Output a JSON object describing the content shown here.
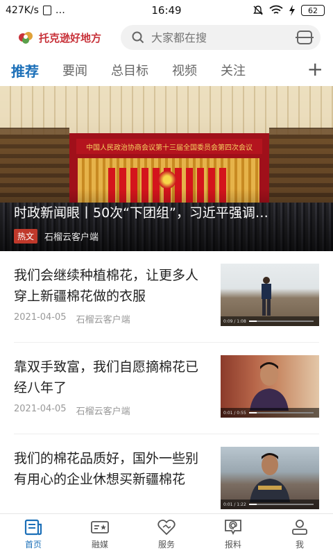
{
  "status_bar": {
    "network_speed": "427K/s",
    "extra": "…",
    "time": "16:49",
    "battery": "62"
  },
  "header": {
    "logo_text": "托克逊好地方",
    "search_placeholder": "大家都在搜"
  },
  "tabs": [
    {
      "label": "推荐",
      "active": true
    },
    {
      "label": "要闻",
      "active": false
    },
    {
      "label": "总目标",
      "active": false
    },
    {
      "label": "视频",
      "active": false
    },
    {
      "label": "关注",
      "active": false
    }
  ],
  "hero": {
    "banner_text": "中国人民政治协商会议第十三届全国委员会第四次会议",
    "title": "时政新闻眼丨50次“下团组”，习近平强调…",
    "badge": "热文",
    "source": "石榴云客户端"
  },
  "news": [
    {
      "title": "我们会继续种植棉花，让更多人穿上新疆棉花做的衣服",
      "date": "2021-04-05",
      "source": "石榴云客户端",
      "video_time": "0:09 / 1:08"
    },
    {
      "title": "靠双手致富，我们自愿摘棉花已经八年了",
      "date": "2021-04-05",
      "source": "石榴云客户端",
      "video_time": "0:01 / 0:55"
    },
    {
      "title": "我们的棉花品质好，国外一些别有用心的企业休想买新疆棉花",
      "date": "",
      "source": "",
      "video_time": "0:01 / 1:22"
    }
  ],
  "bottom_nav": [
    {
      "label": "首页",
      "icon": "home-news-icon",
      "active": true
    },
    {
      "label": "融媒",
      "icon": "media-icon",
      "active": false
    },
    {
      "label": "服务",
      "icon": "heart-service-icon",
      "active": false
    },
    {
      "label": "报料",
      "icon": "report-icon",
      "active": false
    },
    {
      "label": "我",
      "icon": "profile-icon",
      "active": false
    }
  ],
  "colors": {
    "accent": "#1b6fb8",
    "logo": "#c8323a",
    "badge": "#c0392b"
  }
}
